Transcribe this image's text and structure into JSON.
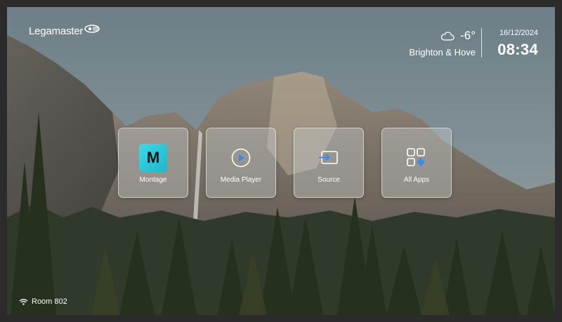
{
  "brand": {
    "logo_text": "Legamaster"
  },
  "weather": {
    "icon": "cloud-icon",
    "temperature": "-6°",
    "location": "Brighton & Hove"
  },
  "clock": {
    "date": "16/12/2024",
    "time": "08:34"
  },
  "apps": [
    {
      "label": "Montage",
      "icon": "montage-icon",
      "icon_text": "M"
    },
    {
      "label": "Media Player",
      "icon": "media-player-icon"
    },
    {
      "label": "Source",
      "icon": "source-input-icon"
    },
    {
      "label": "All Apps",
      "icon": "all-apps-grid-icon"
    }
  ],
  "network": {
    "icon": "wifi-icon",
    "label": "Room 802"
  },
  "colors": {
    "accent_cyan": "#3fd9e8",
    "accent_blue": "#3b8be0",
    "text": "#ffffff"
  }
}
